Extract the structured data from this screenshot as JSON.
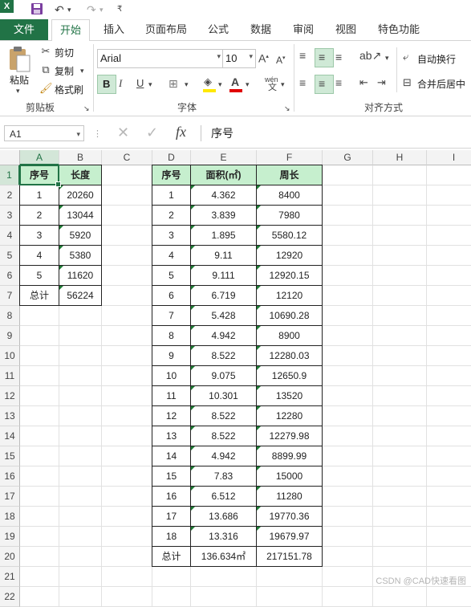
{
  "qat": {
    "app_icon": "excel-icon",
    "undo_icon": "undo-icon",
    "redo_icon": "redo-icon",
    "save_icon": "save-icon"
  },
  "tabs": [
    "文件",
    "开始",
    "插入",
    "页面布局",
    "公式",
    "数据",
    "审阅",
    "视图",
    "特色功能"
  ],
  "ribbon": {
    "paste": "粘贴",
    "cut": "剪切",
    "copy": "复制",
    "format_painter": "格式刷",
    "clipboard_group": "剪贴板",
    "font_name": "Arial",
    "font_size": "10",
    "bold": "B",
    "italic": "I",
    "underline": "U",
    "font_group": "字体",
    "wrap_text": "自动换行",
    "merge_center": "合并后居中",
    "align_group": "对齐方式",
    "phonetic": "wén"
  },
  "formula_bar": {
    "name_box": "A1",
    "fx": "fx",
    "content": "序号"
  },
  "columns": [
    "A",
    "B",
    "C",
    "D",
    "E",
    "F",
    "G",
    "H",
    "I"
  ],
  "rows": [
    "1",
    "2",
    "3",
    "4",
    "5",
    "6",
    "7",
    "8",
    "9",
    "10",
    "11",
    "12",
    "13",
    "14",
    "15",
    "16",
    "17",
    "18",
    "19",
    "20",
    "21",
    "22"
  ],
  "table1": {
    "headers": [
      "序号",
      "长度"
    ],
    "rows": [
      [
        "1",
        "20260"
      ],
      [
        "2",
        "13044"
      ],
      [
        "3",
        "5920"
      ],
      [
        "4",
        "5380"
      ],
      [
        "5",
        "11620"
      ],
      [
        "总计",
        "56224"
      ]
    ]
  },
  "table2": {
    "headers": [
      "序号",
      "面积(㎡)",
      "周长"
    ],
    "rows": [
      [
        "1",
        "4.362",
        "8400"
      ],
      [
        "2",
        "3.839",
        "7980"
      ],
      [
        "3",
        "1.895",
        "5580.12"
      ],
      [
        "4",
        "9.11",
        "12920"
      ],
      [
        "5",
        "9.111",
        "12920.15"
      ],
      [
        "6",
        "6.719",
        "12120"
      ],
      [
        "7",
        "5.428",
        "10690.28"
      ],
      [
        "8",
        "4.942",
        "8900"
      ],
      [
        "9",
        "8.522",
        "12280.03"
      ],
      [
        "10",
        "9.075",
        "12650.9"
      ],
      [
        "11",
        "10.301",
        "13520"
      ],
      [
        "12",
        "8.522",
        "12280"
      ],
      [
        "13",
        "8.522",
        "12279.98"
      ],
      [
        "14",
        "4.942",
        "8899.99"
      ],
      [
        "15",
        "7.83",
        "15000"
      ],
      [
        "16",
        "6.512",
        "11280"
      ],
      [
        "17",
        "13.686",
        "19770.36"
      ],
      [
        "18",
        "13.316",
        "19679.97"
      ],
      [
        "总计",
        "136.634㎡",
        "217151.78"
      ]
    ]
  },
  "watermark": "CSDN @CAD快速看图",
  "colors": {
    "accent": "#217346",
    "header_fill": "#c6efce",
    "error_triangle": "#1e7b34"
  }
}
